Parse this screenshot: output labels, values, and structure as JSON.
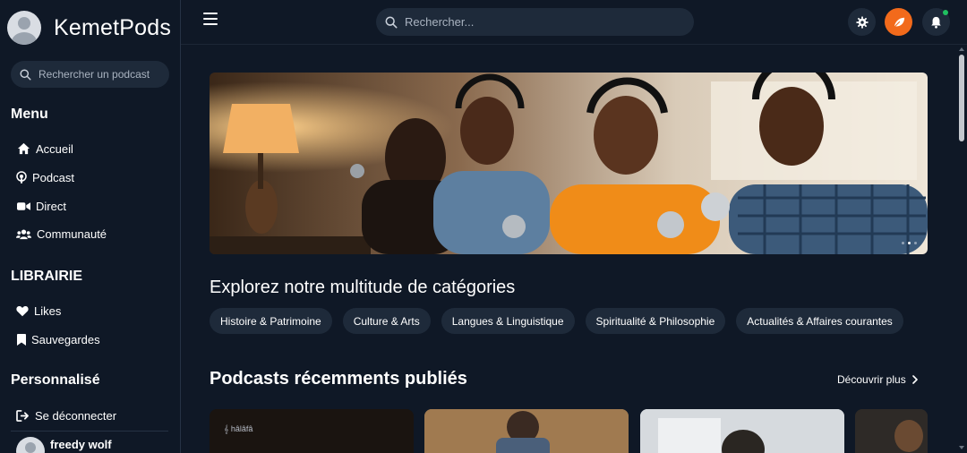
{
  "brand": {
    "name": "KemetPods"
  },
  "sidebar": {
    "search_placeholder": "Rechercher un podcast",
    "menu_title": "Menu",
    "menu_items": [
      {
        "label": "Accueil",
        "icon": "home-icon"
      },
      {
        "label": "Podcast",
        "icon": "podcast-icon"
      },
      {
        "label": "Direct",
        "icon": "video-icon"
      },
      {
        "label": "Communauté",
        "icon": "users-icon"
      }
    ],
    "library_title": "LIBRAIRIE",
    "library_items": [
      {
        "label": "Likes",
        "icon": "heart-icon"
      },
      {
        "label": "Sauvegardes",
        "icon": "bookmark-icon"
      }
    ],
    "custom_title": "Personnalisé",
    "logout_label": "Se déconnecter",
    "user_name": "freedy wolf"
  },
  "topbar": {
    "search_placeholder": "Rechercher...",
    "icons": [
      "menu-icon",
      "search-icon",
      "settings-icon",
      "leaf-icon",
      "bell-icon"
    ],
    "notification_status_color": "#20c060",
    "accent_color": "#f26a1b"
  },
  "main": {
    "categories_title": "Explorez notre multitude de catégories",
    "categories": [
      "Histoire & Patrimoine",
      "Culture & Arts",
      "Langues & Linguistique",
      "Spiritualité & Philosophie",
      "Actualités & Affaires courantes"
    ],
    "recent_title": "Podcasts récemments publiés",
    "more_label": "Découvrir plus",
    "cards": [
      {
        "logo": "𝄞 hâlâfâ"
      },
      {},
      {},
      {}
    ]
  }
}
